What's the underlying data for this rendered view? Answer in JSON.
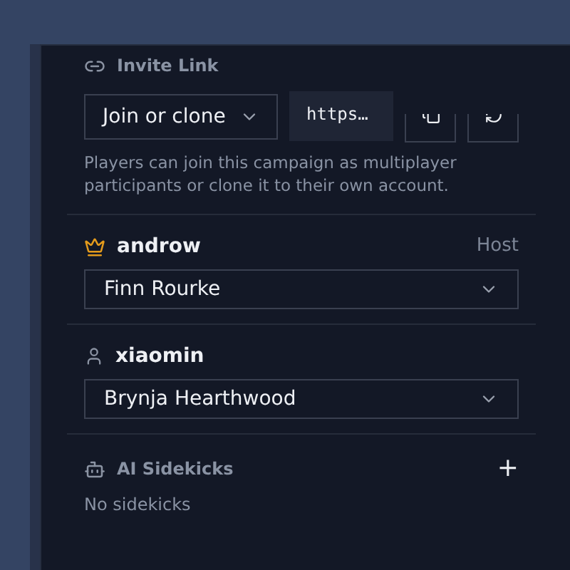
{
  "invite": {
    "title": "Invite Link",
    "mode": "Join or clone",
    "link": "https…",
    "description": "Players can join this campaign as multiplayer participants or clone it to their own account."
  },
  "players": [
    {
      "name": "androw",
      "kind": "host",
      "role": "Host",
      "character": "Finn Rourke"
    },
    {
      "name": "xiaomin",
      "kind": "player",
      "character": "Brynja Hearthwood"
    }
  ],
  "sidekicks": {
    "title": "AI Sidekicks",
    "add": "+",
    "empty": "No sidekicks"
  }
}
